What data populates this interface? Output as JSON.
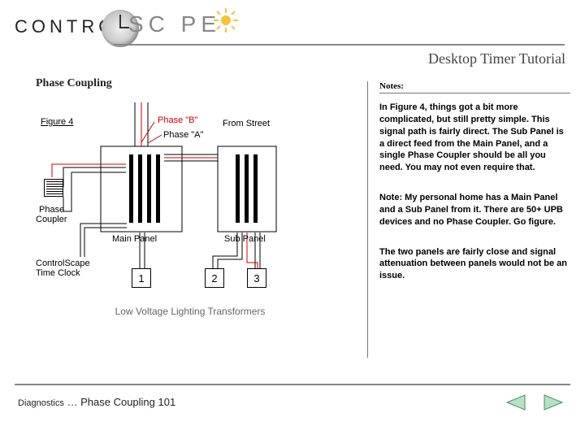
{
  "logo": {
    "left": "CONTROL",
    "right": "SC   PE"
  },
  "header": {
    "title": "Desktop Timer Tutorial",
    "subtitle": "Phase Coupling"
  },
  "notes": {
    "heading": "Notes:",
    "p1": "In Figure 4, things got a bit more complicated, but still pretty simple. This signal path is fairly direct. The Sub Panel is a direct feed from the Main Panel, and a single Phase Coupler should be all you need. You may not even require that.",
    "p2": "Note: My personal home has a Main Panel and a Sub Panel from it. There are 50+ UPB devices and no Phase Coupler.  Go figure.",
    "p3": "The two panels are fairly close and signal attenuation between panels would not be an issue."
  },
  "diagram": {
    "figure": "Figure 4",
    "phase_a": "Phase \"A\"",
    "phase_b": "Phase \"B\"",
    "from_street": "From Street",
    "phase_coupler_l1": "Phase",
    "phase_coupler_l2": "Coupler",
    "main_panel": "Main Panel",
    "sub_panel": "Sub Panel",
    "cs_l1": "ControlScape",
    "cs_l2": "Time Clock",
    "n1": "1",
    "n2": "2",
    "n3": "3",
    "caption": "Low Voltage Lighting Transformers"
  },
  "footer": {
    "prefix": "Diagnostics",
    "dots": "…",
    "title": "Phase Coupling 101"
  }
}
